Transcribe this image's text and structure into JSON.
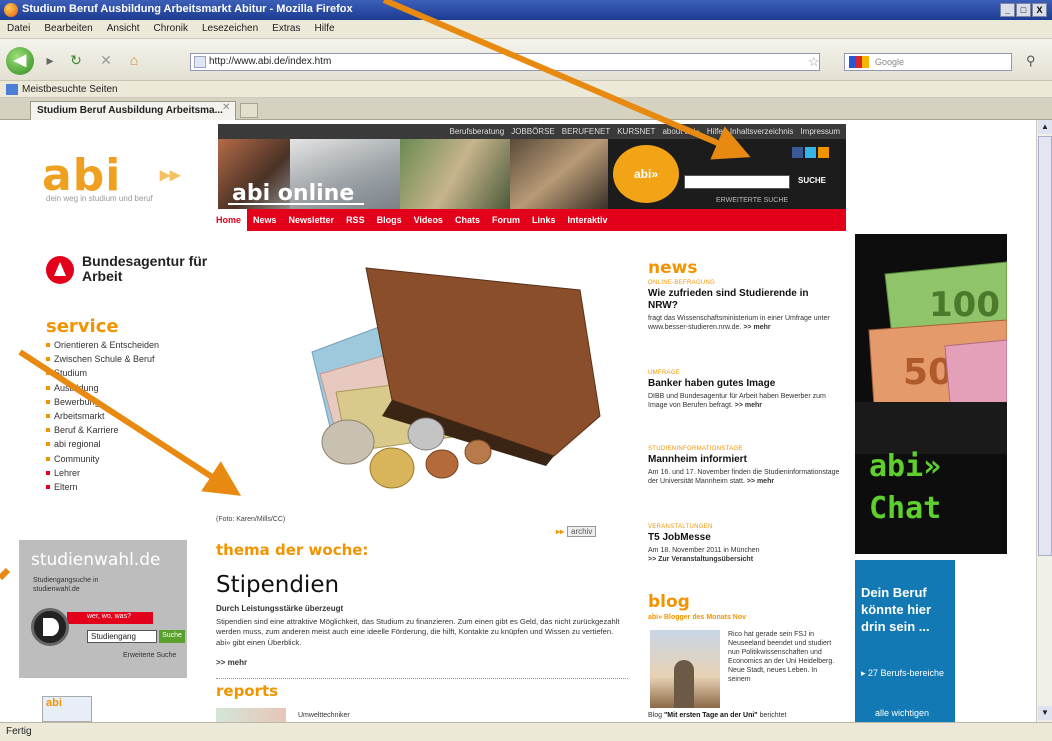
{
  "browser": {
    "title": "Studium Beruf Ausbildung Arbeitsmarkt Abitur - Mozilla Firefox",
    "menu": [
      "Datei",
      "Bearbeiten",
      "Ansicht",
      "Chronik",
      "Lesezeichen",
      "Extras",
      "Hilfe"
    ],
    "url": "http://www.abi.de/index.htm",
    "search_placeholder": "Google",
    "bookmark": "Meistbesuchte Seiten",
    "tab_title": "Studium Beruf Ausbildung Arbeitsma...",
    "status": "Fertig",
    "buttons": {
      "min": "_",
      "max": "□",
      "close": "X"
    }
  },
  "topnav": [
    "Berufsberatung",
    "JOBBÖRSE",
    "BERUFENET",
    "KURSNET",
    "about abi»",
    "Hilfe",
    "Inhaltsverzeichnis",
    "Impressum"
  ],
  "header": {
    "logo": "abi",
    "logo_arrows": "▸▸",
    "slogan": "dein weg in studium und beruf",
    "banner_title": "abi online",
    "badge": "abi»",
    "search_button": "SUCHE",
    "search_sub": "ERWEITERTE SUCHE"
  },
  "mainnav": [
    "Home",
    "News",
    "Newsletter",
    "RSS",
    "Blogs",
    "Videos",
    "Chats",
    "Forum",
    "Links",
    "Interaktiv"
  ],
  "sidebar": {
    "ba_name": "Bundesagentur für Arbeit",
    "service_title": "service",
    "items": [
      "Orientieren & Entscheiden",
      "Zwischen Schule & Beruf",
      "Studium",
      "Ausbildung",
      "Bewerbung",
      "Arbeitsmarkt",
      "Beruf & Karriere",
      "abi regional",
      "Community",
      "Lehrer",
      "Eltern"
    ],
    "studienwahl": {
      "title": "studienwahl.de",
      "sub": "Studiengangsuche in studienwahl.de",
      "red_label": "wer, wo, was?",
      "input": "Studiengang",
      "button": "Suche",
      "extended": "Erweiterte Suche"
    },
    "magazine": "abi"
  },
  "thema": {
    "caption": "(Foto: Karen/Mills/CC)",
    "archive_label": "archiv",
    "section": "thema der woche:",
    "headline": "Stipendien",
    "subhead": "Durch Leistungsstärke überzeugt",
    "text": "Stipendien sind eine attraktive Möglichkeit, das Studium zu finanzieren. Zum einen gibt es Geld, das nicht zurückgezahlt werden muss, zum anderen meist auch eine ideelle Förderung, die hilft, Kontakte zu knüpfen und Wissen zu vertiefen. abi» gibt einen Überblick.",
    "more": ">> mehr",
    "reports_title": "reports",
    "reports_item": "Umwelttechniker"
  },
  "news": {
    "title": "news",
    "items": [
      {
        "kicker": "Online-Befragung",
        "head": "Wie zufrieden sind Studierende in NRW?",
        "body": "fragt das Wissenschaftsministerium in einer Umfrage unter www.besser-studieren.nrw.de.",
        "more": ">> mehr"
      },
      {
        "kicker": "Umfrage",
        "head": "Banker haben gutes Image",
        "body": "DIBB und Bundesagentur für Arbeit haben Bewerber zum Image von Berufen befragt.",
        "more": ">> mehr"
      },
      {
        "kicker": "Studieninformationstage",
        "head": "Mannheim informiert",
        "body": "Am 16. und 17. November finden die Studieninformationstage der Universität Mannheim statt.",
        "more": ">> mehr"
      },
      {
        "kicker": "Veranstaltungen",
        "head": "T5 JobMesse",
        "body": "Am 18. November 2011 in München",
        "more": ">> Zur Veranstaltungsübersicht"
      }
    ]
  },
  "blog": {
    "title": "blog",
    "sub": "abi» Blogger des Monats Nov",
    "text": "Rico hat gerade sein FSJ in Neuseeland beendet und studiert nun Politikwissenschaften und Economics an der Uni Heidelberg. Neue Stadt, neues Leben. In seinem",
    "foot_prefix": "Blog",
    "foot_link": "\"Mit ersten Tage an der Uni\"",
    "foot_suffix": "berichtet"
  },
  "ads": {
    "chat": "abi» Chat",
    "beruf_big": "Dein Beruf könnte hier drin sein ...",
    "beruf_small": "▸ 27 Berufs-bereiche",
    "beruf_small2": "alle wichtigen"
  },
  "colors": {
    "brand_orange": "#f29400",
    "brand_red": "#e2001a",
    "dark": "#3a3a3a",
    "annotation": "#e88a12"
  }
}
